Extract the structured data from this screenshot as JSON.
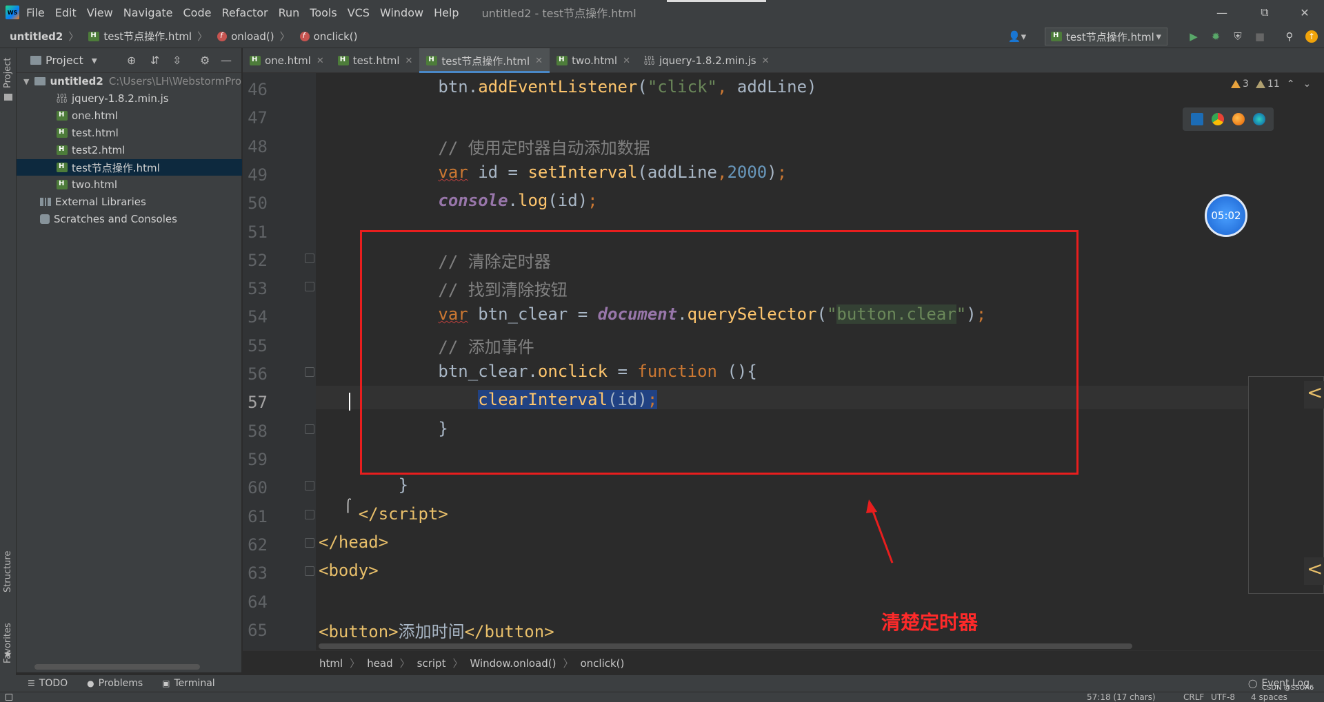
{
  "app": {
    "menu": [
      "File",
      "Edit",
      "View",
      "Navigate",
      "Code",
      "Refactor",
      "Run",
      "Tools",
      "VCS",
      "Window",
      "Help"
    ],
    "title": "untitled2 - test节点操作.html",
    "logo_text": "WS"
  },
  "navbar": {
    "crumbs": [
      "untitled2",
      "test节点操作.html",
      "onload()",
      "onclick()"
    ],
    "run_config": "test节点操作.html"
  },
  "project": {
    "header": "Project",
    "root_name": "untitled2",
    "root_path": "C:\\Users\\LH\\WebstormPro",
    "files": [
      "jquery-1.8.2.min.js",
      "one.html",
      "test.html",
      "test2.html",
      "test节点操作.html",
      "two.html"
    ],
    "selected": "test节点操作.html",
    "external": "External Libraries",
    "scratches": "Scratches and Consoles"
  },
  "side_labels": {
    "project": "Project",
    "structure": "Structure",
    "favorites": "Favorites"
  },
  "tabs": [
    "one.html",
    "test.html",
    "test节点操作.html",
    "two.html",
    "jquery-1.8.2.min.js"
  ],
  "active_tab": "test节点操作.html",
  "editor": {
    "line_numbers": [
      "46",
      "47",
      "48",
      "49",
      "50",
      "51",
      "52",
      "53",
      "54",
      "55",
      "56",
      "57",
      "58",
      "59",
      "60",
      "61",
      "62",
      "63",
      "64",
      "65"
    ],
    "current_line": "57",
    "warnings": "3",
    "weak_warnings": "11"
  },
  "timer": "05:02",
  "annotation": "清楚定时器",
  "breadcrumb": [
    "html",
    "head",
    "script",
    "Window.onload()",
    "onclick()"
  ],
  "bottom_tools": [
    "TODO",
    "Problems",
    "Terminal"
  ],
  "event_log": "Event Log",
  "status": {
    "position": "57:18 (17 chars)",
    "line_sep": "CRLF",
    "encoding": "UTF-8",
    "indent": "4 spaces",
    "watermark": "CSDN @SSOA6"
  },
  "colors": {
    "red_box": "#e81e1e",
    "annotation": "#ff2a2a",
    "selection": "#214283",
    "tab_accent": "#4a88c7"
  }
}
